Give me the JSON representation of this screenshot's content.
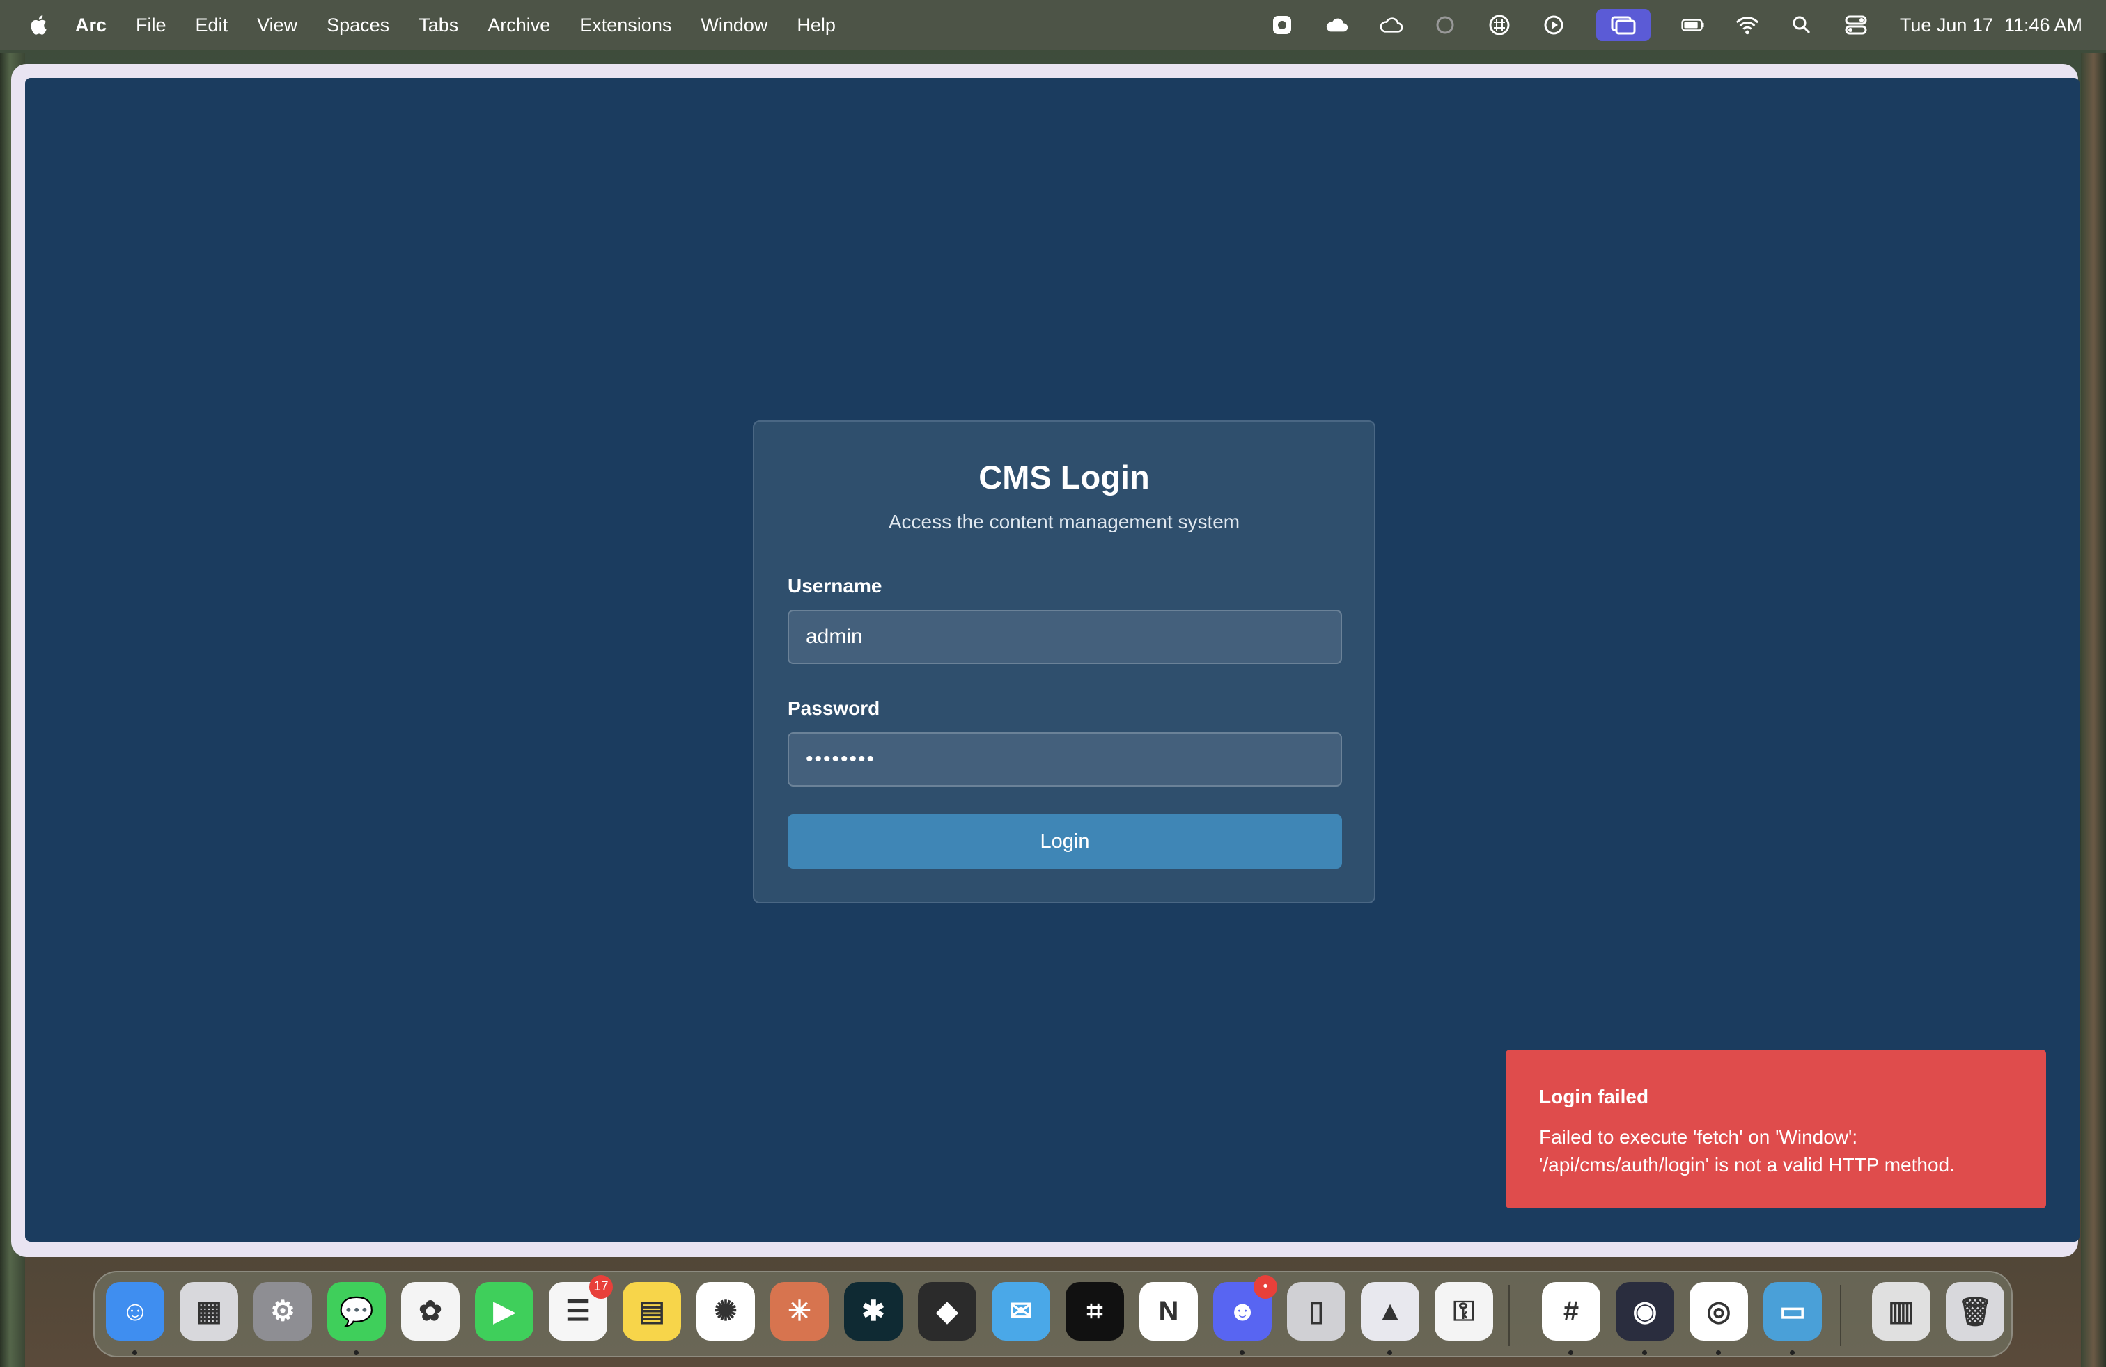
{
  "menubar": {
    "app_name": "Arc",
    "items": [
      "File",
      "Edit",
      "View",
      "Spaces",
      "Tabs",
      "Archive",
      "Extensions",
      "Window",
      "Help"
    ],
    "date": "Tue Jun 17",
    "time": "11:46 AM",
    "status_icons": [
      "screen-capture-icon",
      "cloud-icon",
      "cloud-sync-icon",
      "moon-icon",
      "grid-icon",
      "play-icon",
      "screen-mirroring-icon",
      "battery-icon",
      "wifi-icon",
      "search-icon",
      "control-center-icon"
    ]
  },
  "login": {
    "title": "CMS Login",
    "subtitle": "Access the content management system",
    "username_label": "Username",
    "username_value": "admin",
    "password_label": "Password",
    "password_value": "••••••••",
    "button_label": "Login"
  },
  "toast": {
    "title": "Login failed",
    "message": "Failed to execute 'fetch' on 'Window': '/api/cms/auth/login' is not a valid HTTP method."
  },
  "dock": {
    "apps": [
      {
        "name": "Finder",
        "color": "#3f8ef0",
        "glyph": "☺"
      },
      {
        "name": "Launchpad",
        "color": "#d8d8dc",
        "glyph": "▦"
      },
      {
        "name": "System Settings",
        "color": "#8e8e93",
        "glyph": "⚙"
      },
      {
        "name": "Messages",
        "color": "#3fcf5b",
        "glyph": "💬"
      },
      {
        "name": "Photos",
        "color": "#f4f4f4",
        "glyph": "✿"
      },
      {
        "name": "FaceTime",
        "color": "#3fcf5b",
        "glyph": "▶"
      },
      {
        "name": "Reminders",
        "color": "#f6f6f6",
        "glyph": "☰",
        "badge": "17"
      },
      {
        "name": "Notes",
        "color": "#f7d54a",
        "glyph": "▤"
      },
      {
        "name": "ChatGPT",
        "color": "#ffffff",
        "glyph": "✺"
      },
      {
        "name": "Claude",
        "color": "#d7744f",
        "glyph": "✳"
      },
      {
        "name": "Perplexity",
        "color": "#0f2a33",
        "glyph": "✱"
      },
      {
        "name": "Linear",
        "color": "#2b2b2b",
        "glyph": "◆"
      },
      {
        "name": "Airmail",
        "color": "#4aa8e8",
        "glyph": "✉"
      },
      {
        "name": "Screenshot",
        "color": "#111111",
        "glyph": "⌗"
      },
      {
        "name": "Notion",
        "color": "#ffffff",
        "glyph": "N"
      },
      {
        "name": "Discord",
        "color": "#5865f2",
        "glyph": "☻",
        "badge": "•"
      },
      {
        "name": "iPhone Mirroring",
        "color": "#d0d0d4",
        "glyph": "▯"
      },
      {
        "name": "Affinity",
        "color": "#e8e8ee",
        "glyph": "▲"
      },
      {
        "name": "Passwords",
        "color": "#f4f4f4",
        "glyph": "⚿"
      },
      {
        "name": "Slack",
        "color": "#ffffff",
        "glyph": "#"
      },
      {
        "name": "OBS",
        "color": "#2a2d3e",
        "glyph": "◉"
      },
      {
        "name": "Chrome",
        "color": "#ffffff",
        "glyph": "◎"
      },
      {
        "name": "Display",
        "color": "#4aa0d8",
        "glyph": "▭"
      },
      {
        "name": "Archive",
        "color": "#e0e0e0",
        "glyph": "▥"
      },
      {
        "name": "Trash",
        "color": "#d8d8dc",
        "glyph": "🗑"
      }
    ]
  }
}
